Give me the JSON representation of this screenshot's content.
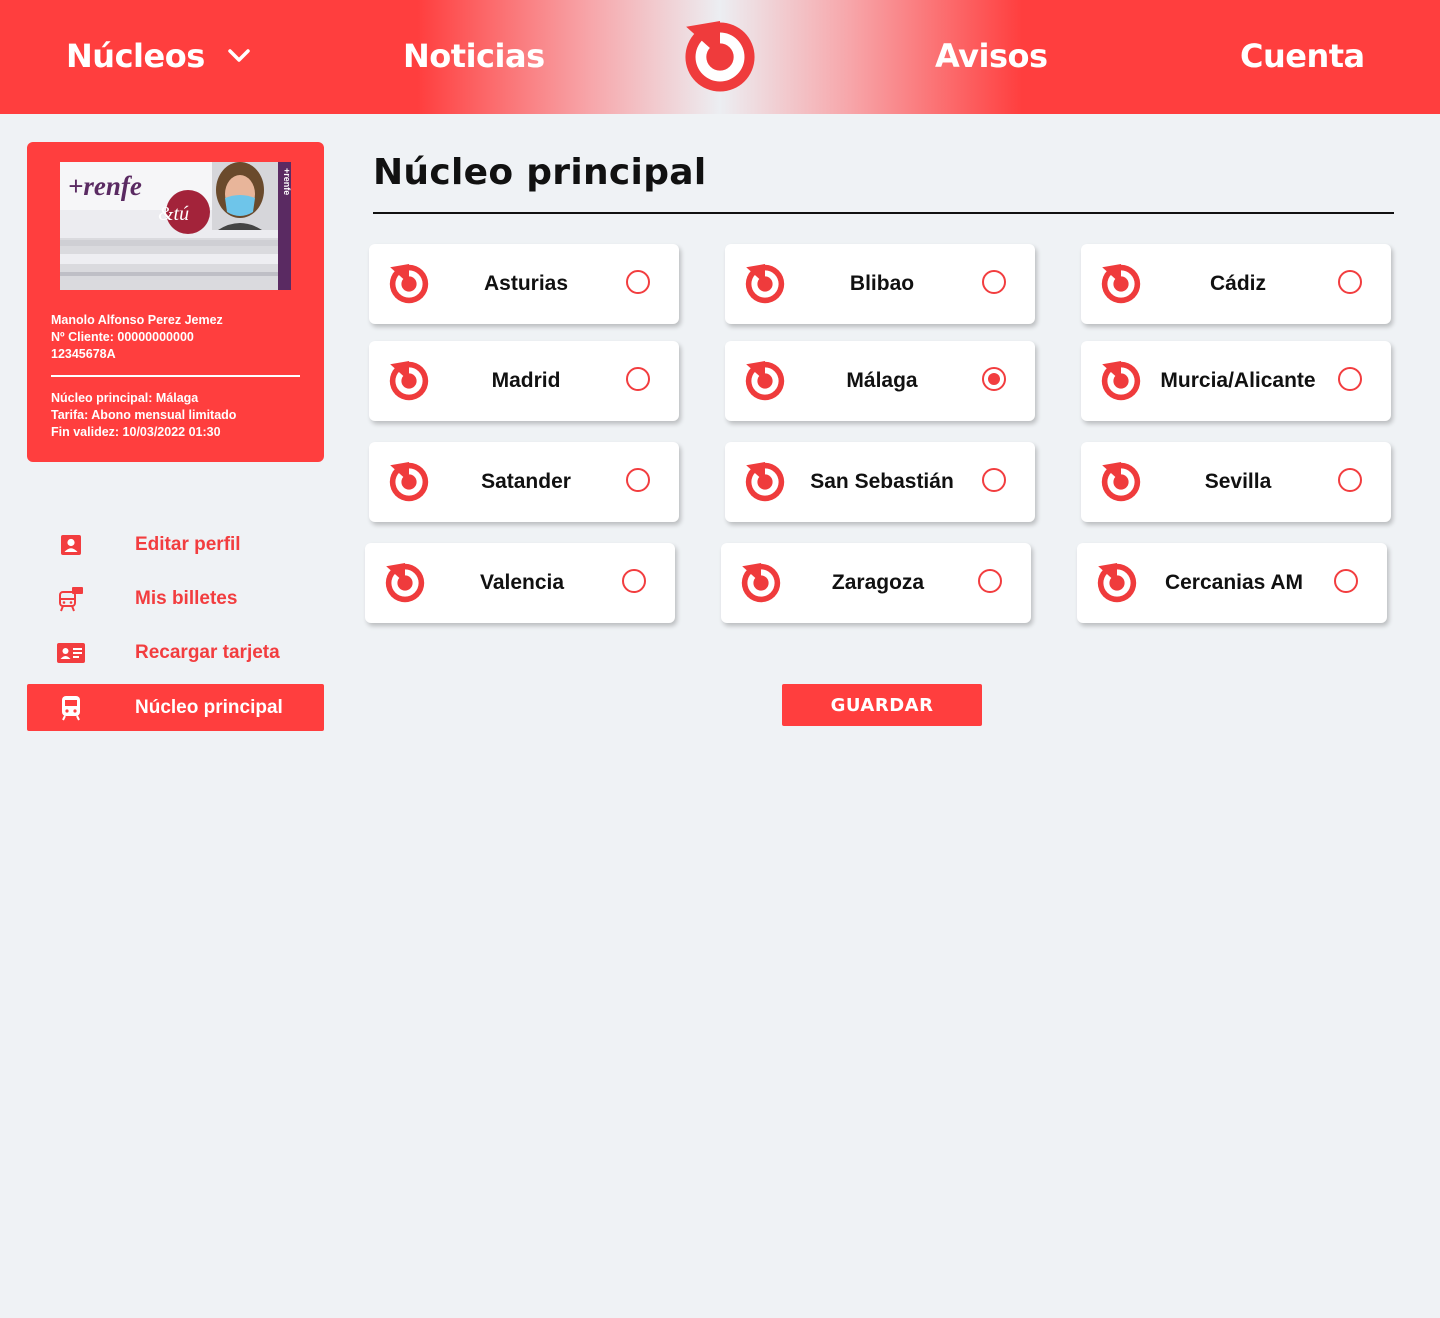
{
  "header": {
    "nav": {
      "nucleos": "Núcleos",
      "noticias": "Noticias",
      "avisos": "Avisos",
      "cuenta": "Cuenta"
    },
    "logo_icon": "renfe-logo-icon"
  },
  "profile_card": {
    "card_brand": "+renfe",
    "card_brand_suffix": "&tú",
    "card_side_brand": "+renfe",
    "name": "Manolo Alfonso Perez Jemez",
    "client_number": "Nº Cliente: 00000000000",
    "document_id": "12345678A",
    "nucleo": "Núcleo principal: Málaga",
    "tarifa": "Tarifa: Abono mensual limitado",
    "validez": "Fin validez: 10/03/2022 01:30"
  },
  "side_menu": [
    {
      "label": "Editar perfil",
      "icon": "user-profile-icon"
    },
    {
      "label": "Mis billetes",
      "icon": "train-ticket-icon"
    },
    {
      "label": "Recargar tarjeta",
      "icon": "id-card-icon"
    },
    {
      "label": "Núcleo principal",
      "icon": "train-icon"
    }
  ],
  "main": {
    "title": "Núcleo principal",
    "options": [
      {
        "label": "Asturias",
        "selected": false
      },
      {
        "label": "Blibao",
        "selected": false
      },
      {
        "label": "Cádiz",
        "selected": false
      },
      {
        "label": "Madrid",
        "selected": false
      },
      {
        "label": "Málaga",
        "selected": true
      },
      {
        "label": "Murcia/Alicante",
        "selected": false
      },
      {
        "label": "Satander",
        "selected": false
      },
      {
        "label": "San Sebastián",
        "selected": false
      },
      {
        "label": "Sevilla",
        "selected": false
      },
      {
        "label": "Valencia",
        "selected": false
      },
      {
        "label": "Zaragoza",
        "selected": false
      },
      {
        "label": "Cercanias AM",
        "selected": false
      }
    ],
    "save_label": "GUARDAR"
  },
  "colors": {
    "accent": "#ff3e3e",
    "background": "#eff2f5",
    "text": "#111111"
  }
}
